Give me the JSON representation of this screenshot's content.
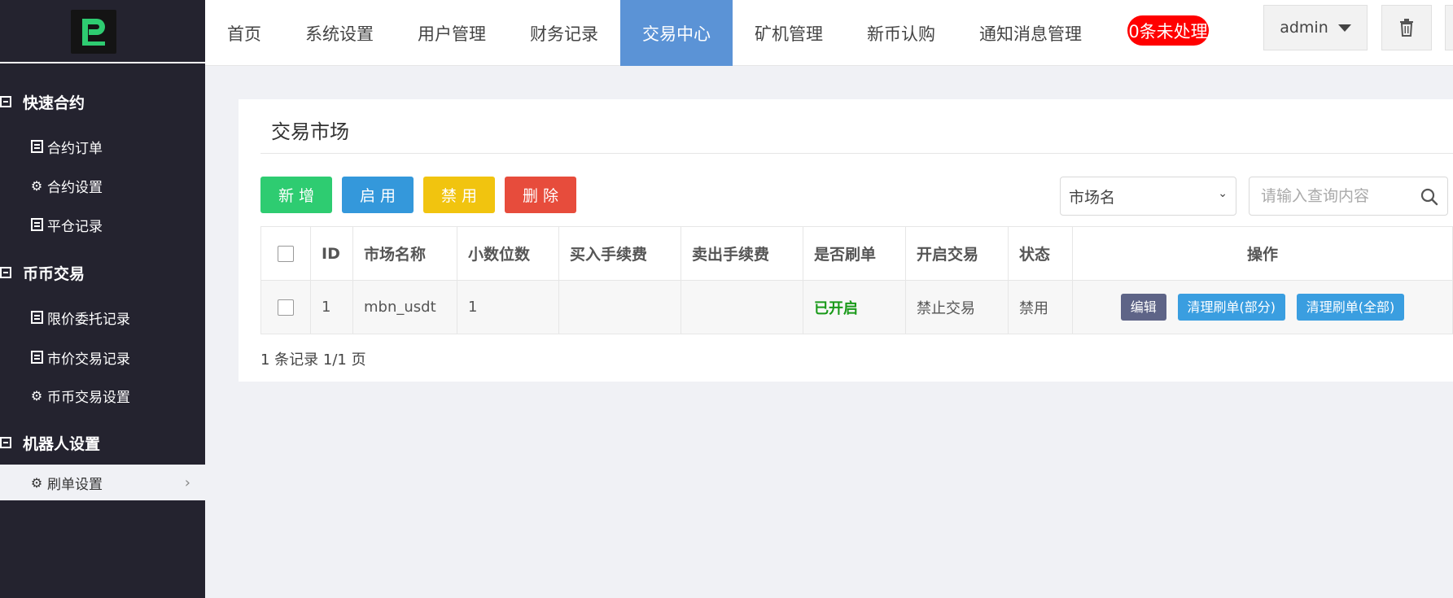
{
  "sidebar": {
    "groups": [
      {
        "title": "快速合约",
        "items": [
          {
            "icon": "list-icon",
            "label": "合约订单"
          },
          {
            "icon": "gear-icon",
            "label": "合约设置"
          },
          {
            "icon": "list-icon",
            "label": "平仓记录"
          }
        ]
      },
      {
        "title": "币币交易",
        "items": [
          {
            "icon": "list-icon",
            "label": "限价委托记录"
          },
          {
            "icon": "list-icon",
            "label": "市价交易记录"
          },
          {
            "icon": "gear-icon",
            "label": "币币交易设置"
          }
        ]
      },
      {
        "title": "机器人设置",
        "items": [
          {
            "icon": "gear-icon",
            "label": "刷单设置",
            "active": true
          }
        ]
      }
    ]
  },
  "topnav": {
    "items": [
      "首页",
      "系统设置",
      "用户管理",
      "财务记录",
      "交易中心",
      "矿机管理",
      "新币认购",
      "通知消息管理"
    ],
    "active": "交易中心",
    "notice_badge": "0条未处理",
    "user": "admin"
  },
  "panel": {
    "title": "交易市场",
    "buttons": {
      "add": "新增",
      "enable": "启用",
      "disable": "禁用",
      "delete": "删除"
    },
    "filter_select": "市场名",
    "search_placeholder": "请输入查询内容",
    "table": {
      "headers": [
        "ID",
        "市场名称",
        "小数位数",
        "买入手续费",
        "卖出手续费",
        "是否刷单",
        "开启交易",
        "状态",
        "操作"
      ],
      "rows": [
        {
          "id": "1",
          "name": "mbn_usdt",
          "decimals": "1",
          "buy_fee": "",
          "sell_fee": "",
          "brush": "已开启",
          "trade": "禁止交易",
          "status": "禁用",
          "actions": {
            "edit": "编辑",
            "clear_partial": "清理刷单(部分)",
            "clear_all": "清理刷单(全部)"
          }
        }
      ]
    },
    "pager": "1 条记录 1/1 页"
  },
  "colors": {
    "sidebar_bg": "#24232f",
    "active_nav": "#5b93d6",
    "add": "#2ecc71",
    "enable": "#3498db",
    "disable": "#f1c40f",
    "delete": "#e74c3c",
    "badge": "#ff0000"
  }
}
